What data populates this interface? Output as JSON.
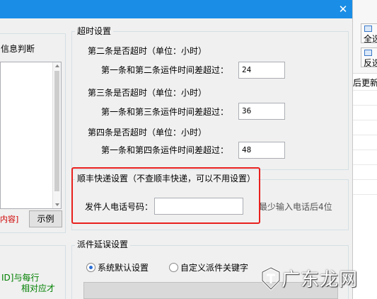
{
  "window": {
    "close_glyph": "✕"
  },
  "left_group": {
    "title": "信息判断",
    "red_text": "内容]",
    "example_button": "示例",
    "green_line1": "ID]与每行",
    "green_line2": "相对应才"
  },
  "timeout_group": {
    "title": "超时设置",
    "rows": [
      {
        "heading": "第二条是否超时（单位：小时）",
        "label": "第一条和第二条运件时间差超过：",
        "value": "24"
      },
      {
        "heading": "第三条是否超时（单位：小时）",
        "label": "第一条和第三条运件时间差超过：",
        "value": "36"
      },
      {
        "heading": "第四条是否超时（单位：小时）",
        "label": "第一条和第四条运件时间差超过：",
        "value": "48"
      }
    ]
  },
  "sf_group": {
    "title": "顺丰快递设置（不查顺丰快递，可以不用设置）",
    "phone_label": "发件人电话号码：",
    "phone_value": "",
    "hint": "最少输入电话后4位"
  },
  "dispatch_group": {
    "title": "派件延误设置",
    "option_default": "系统默认设置",
    "option_custom": "自定义派件关键字",
    "selected": "系统默认设置"
  },
  "right_panel": {
    "button1": "全选",
    "button2": "反选",
    "header": "后更新"
  },
  "watermark": {
    "text": "广东龙网"
  }
}
